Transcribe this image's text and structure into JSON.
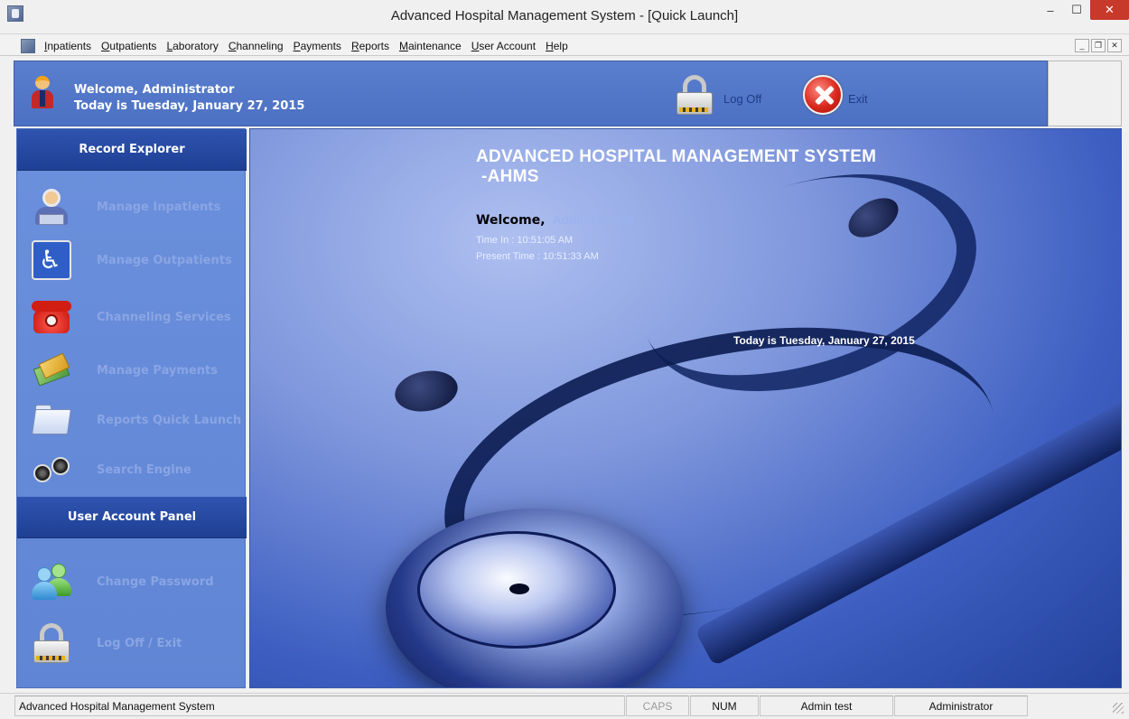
{
  "window": {
    "title": "Advanced Hospital Management System - [Quick Launch]",
    "min_glyph": "–",
    "max_glyph": "☐",
    "close_glyph": "✕"
  },
  "menu": {
    "items": [
      {
        "ul": "I",
        "rest": "npatients"
      },
      {
        "ul": "O",
        "rest": "utpatients"
      },
      {
        "ul": "L",
        "rest": "aboratory"
      },
      {
        "ul": "C",
        "rest": "hanneling"
      },
      {
        "ul": "P",
        "rest": "ayments"
      },
      {
        "ul": "R",
        "rest": "eports"
      },
      {
        "ul": "M",
        "rest": "aintenance"
      },
      {
        "ul": "U",
        "rest": "ser Account"
      },
      {
        "ul": "H",
        "rest": "elp"
      }
    ],
    "mdi_min": "_",
    "mdi_restore": "❐",
    "mdi_close": "✕"
  },
  "header": {
    "welcome": "Welcome, Administrator",
    "date": "Today is Tuesday, January 27, 2015",
    "logoff_label": "Log Off",
    "exit_label": "Exit"
  },
  "sidebar": {
    "record_explorer_title": "Record Explorer",
    "record_items": [
      {
        "label": "Manage Inpatients",
        "icon": "inpatient-icon"
      },
      {
        "label": "Manage Outpatients",
        "icon": "wheelchair-icon"
      },
      {
        "label": "Channeling Services",
        "icon": "telephone-icon"
      },
      {
        "label": "Manage Payments",
        "icon": "money-icon"
      },
      {
        "label": "Reports Quick Launch",
        "icon": "folder-icon"
      },
      {
        "label": "Search Engine",
        "icon": "binoculars-icon"
      }
    ],
    "user_panel_title": "User Account Panel",
    "user_items": [
      {
        "label": "Change Password",
        "icon": "users-icon"
      },
      {
        "label": "Log Off / Exit",
        "icon": "lock-icon"
      }
    ]
  },
  "main": {
    "title_line1": "ADVANCED HOSPITAL MANAGEMENT SYSTEM",
    "title_line2": "-AHMS",
    "welcome_label": "Welcome,",
    "welcome_user": "Administrator",
    "time_in": "Time In :  10:51:05 AM",
    "present_time": "Present Time :  10:51:33 AM",
    "today": "Today is Tuesday, January 27, 2015"
  },
  "statusbar": {
    "app_name": "Advanced Hospital Management System",
    "caps": "CAPS",
    "num": "NUM",
    "user": "Admin test",
    "role": "Administrator"
  },
  "colors": {
    "header_blue": "#5a7fcf",
    "panel_header": "#1f3f94",
    "sidebar_label": "#8aa5e4",
    "close_red": "#c7392b"
  }
}
